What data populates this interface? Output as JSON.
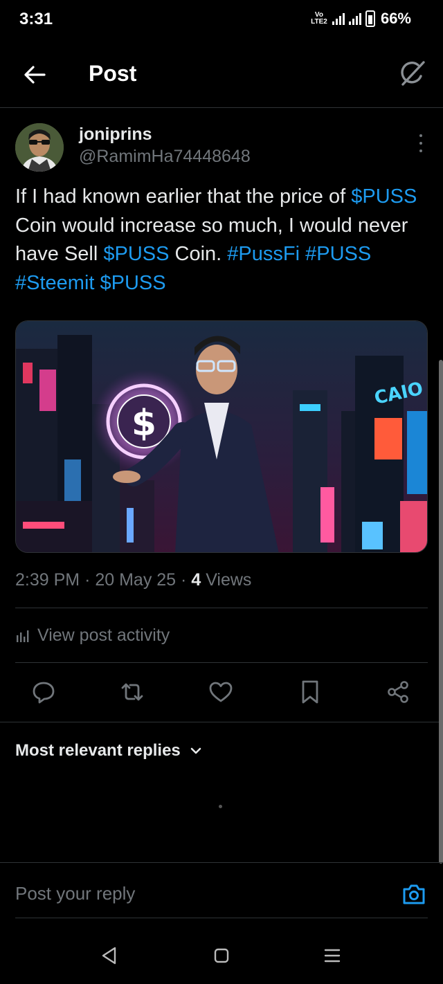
{
  "status_bar": {
    "time": "3:31",
    "network_label": "Vo LTE2",
    "battery": "66%"
  },
  "header": {
    "title": "Post",
    "back_icon": "arrow-left-icon",
    "grok_icon": "grok-icon"
  },
  "post": {
    "author_name": "joniprins",
    "author_handle": "@RamimHa74448648",
    "text_parts": [
      {
        "text": "If I had known earlier that the price of ",
        "link": false
      },
      {
        "text": "$PUSS",
        "link": true
      },
      {
        "text": " Coin would increase so much, I would never have Sell ",
        "link": false
      },
      {
        "text": "$PUSS",
        "link": true
      },
      {
        "text": " Coin. ",
        "link": false
      },
      {
        "text": "#PussFi",
        "link": true
      },
      {
        "text": " ",
        "link": false
      },
      {
        "text": "#PUSS",
        "link": true
      },
      {
        "text": " ",
        "link": false
      },
      {
        "text": "#Steemit",
        "link": true
      },
      {
        "text": " ",
        "link": false
      },
      {
        "text": "$PUSS",
        "link": true
      }
    ],
    "time": "2:39 PM",
    "date": "20 May 25",
    "views_count": "4",
    "views_label": "Views",
    "separator": "·",
    "activity_label": "View post activity"
  },
  "actions": [
    "reply-icon",
    "repost-icon",
    "like-icon",
    "bookmark-icon",
    "share-icon"
  ],
  "replies": {
    "sort_label": "Most relevant replies"
  },
  "composer": {
    "placeholder": "Post your reply"
  },
  "colors": {
    "background": "#000000",
    "accent": "#1d9bf0",
    "secondary_text": "#71767b",
    "primary_text": "#e7e9ea",
    "divider": "#2f3336"
  }
}
